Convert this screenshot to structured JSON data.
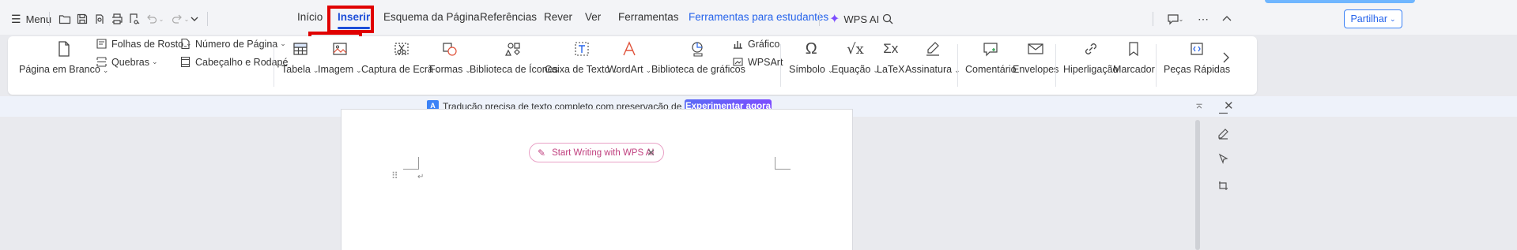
{
  "topbar": {
    "menu_label": "Menu",
    "tabs": [
      "Início",
      "Inserir",
      "Esquema da Página",
      "Referências",
      "Rever",
      "Ver",
      "Ferramentas",
      "Ferramentas para estudantes"
    ],
    "active_tab": "Inserir",
    "wps_ai_label": "WPS AI",
    "share_label": "Partilhar"
  },
  "ribbon": {
    "blank_page": "Página em Branco",
    "cover_pages": "Folhas de Rosto",
    "breaks": "Quebras",
    "page_number": "Número de Página",
    "header_footer": "Cabeçalho e Rodapé",
    "table": "Tabela",
    "image": "Imagem",
    "screenshot": "Captura de Ecrã",
    "shapes": "Formas",
    "icon_library": "Biblioteca de Ícones",
    "text_box": "Caixa de Texto",
    "wordart": "WordArt",
    "chart_library": "Biblioteca de gráficos",
    "chart": "Gráfico",
    "wpsart": "WPSArt",
    "symbol": "Símbolo",
    "equation": "Equação",
    "latex": "LaTeX",
    "signature": "Assinatura",
    "comment": "Comentário",
    "envelopes": "Envelopes",
    "hyperlink": "Hiperligação",
    "bookmark": "Marcador",
    "quick_parts": "Peças Rápidas"
  },
  "notification": {
    "text": "Tradução precisa de texto completo com preservação de formato.",
    "button": "Experimentar agora"
  },
  "document": {
    "ai_prompt": "Start Writing with WPS AI"
  },
  "colors": {
    "accent": "#1d4ed8",
    "highlight": "#e00000",
    "ai_pink": "#c0407f"
  }
}
